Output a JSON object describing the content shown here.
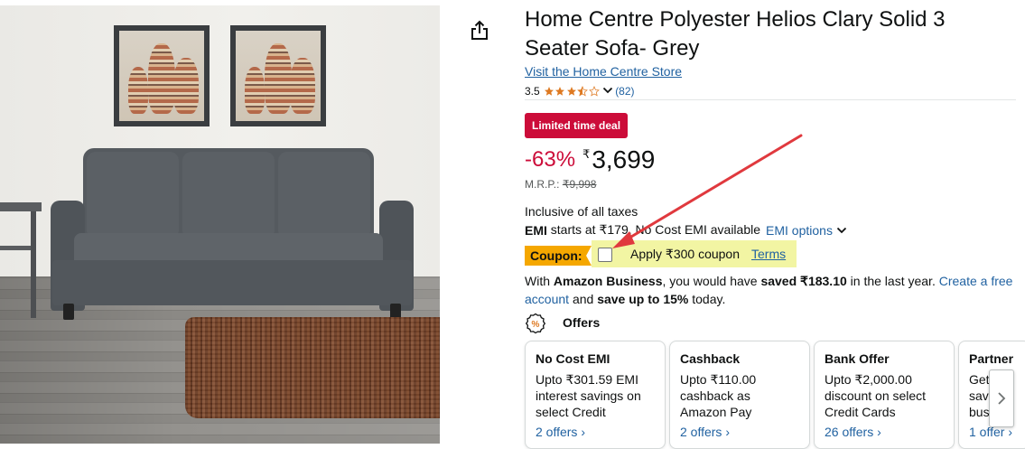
{
  "product": {
    "title": "Home Centre Polyester Helios Clary Solid 3 Seater Sofa- Grey",
    "store_link": "Visit the Home Centre Store",
    "rating": "3.5",
    "rating_count": "(82)",
    "rating_stars": 3.5,
    "deal_badge": "Limited time deal",
    "discount": "-63%",
    "currency_symbol": "₹",
    "price": "3,699",
    "mrp_label": "M.R.P.:",
    "mrp_value": "₹9,998",
    "tax_note": "Inclusive of all taxes"
  },
  "emi": {
    "label_bold": "EMI",
    "text": "starts at ₹179. No Cost EMI available",
    "options_link": "EMI options"
  },
  "coupon": {
    "tag": "Coupon:",
    "apply_text": "Apply ₹300 coupon",
    "terms_link": "Terms",
    "checked": false
  },
  "business": {
    "t1": "With",
    "brand": "Amazon Business",
    "t2": ", you would have",
    "saved_label": "saved ₹183.10",
    "t3": "in the last year.",
    "link1": "Create a free",
    "link2": "account",
    "t4": "and",
    "save_up": "save up to 15%",
    "t5": "today."
  },
  "offers": {
    "title": "Offers",
    "cards": [
      {
        "title": "No Cost EMI",
        "description": "Upto ₹301.59 EMI interest savings on select Credit Cards…",
        "link": "2 offers ›"
      },
      {
        "title": "Cashback",
        "description": "Upto ₹110.00 cashback as Amazon Pay Balance when…",
        "link": "2 offers ›"
      },
      {
        "title": "Bank Offer",
        "description": "Upto ₹2,000.00 discount on select Credit Cards",
        "link": "26 offers ›"
      },
      {
        "title": "Partner",
        "description": "Get save bus",
        "link": "1 offer ›"
      }
    ]
  },
  "colors": {
    "deal_red": "#cc0c39",
    "link_blue": "#2162a1",
    "star_orange": "#de7921",
    "coupon_orange": "#f5a700",
    "coupon_highlight": "#f2f5a3",
    "annotation_arrow": "#e0393e"
  },
  "icons": {
    "share": "share-icon",
    "offers": "offer-percent-icon",
    "chevron": "chevron-down-icon",
    "next": "chevron-right-icon"
  }
}
